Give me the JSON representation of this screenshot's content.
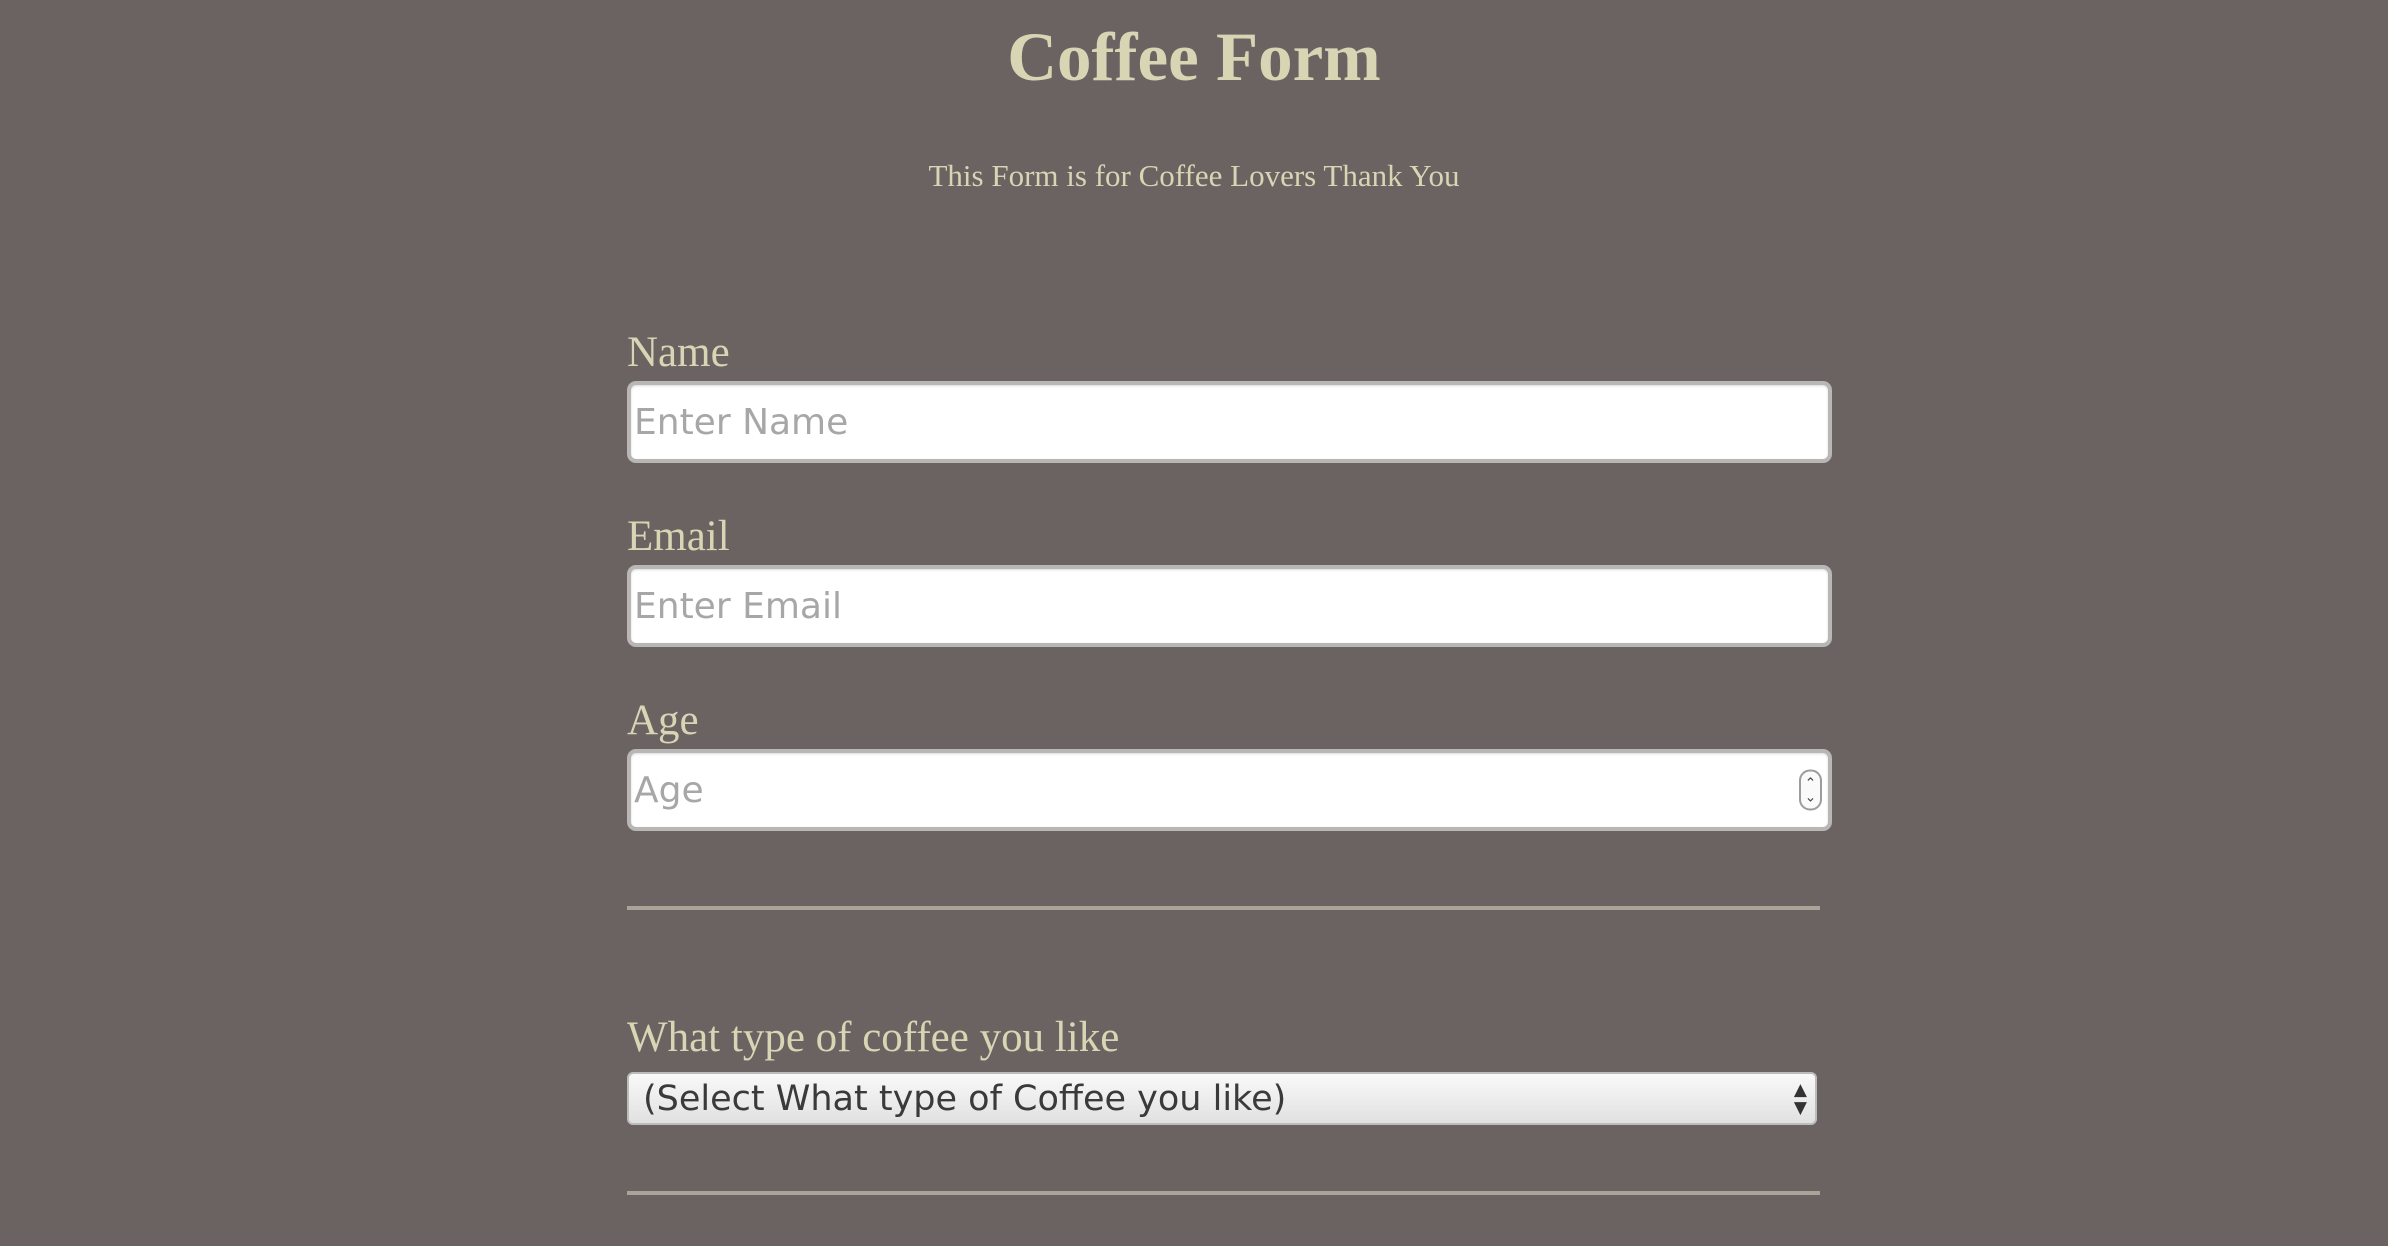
{
  "header": {
    "title": "Coffee Form",
    "subtitle": "This Form is for Coffee Lovers Thank You"
  },
  "form": {
    "name": {
      "label": "Name",
      "value": "",
      "placeholder": "Enter Name"
    },
    "email": {
      "label": "Email",
      "value": "",
      "placeholder": "Enter Email"
    },
    "age": {
      "label": "Age",
      "value": "",
      "placeholder": "Age",
      "spinner_up": "⌃",
      "spinner_down": "⌄"
    },
    "coffee_type": {
      "label": "What type of coffee you like",
      "selected": "(Select What type of Coffee you like)",
      "arrow_up": "▲",
      "arrow_down": "▼"
    }
  },
  "colors": {
    "background": "#6b6262",
    "text": "#d7d5b4",
    "divider": "#a8a497",
    "input_bg": "#ffffff",
    "placeholder": "#a7a7a7"
  },
  "icons": {
    "age_spinner": "spinner-arrows-icon",
    "select_arrows": "select-updown-icon"
  }
}
